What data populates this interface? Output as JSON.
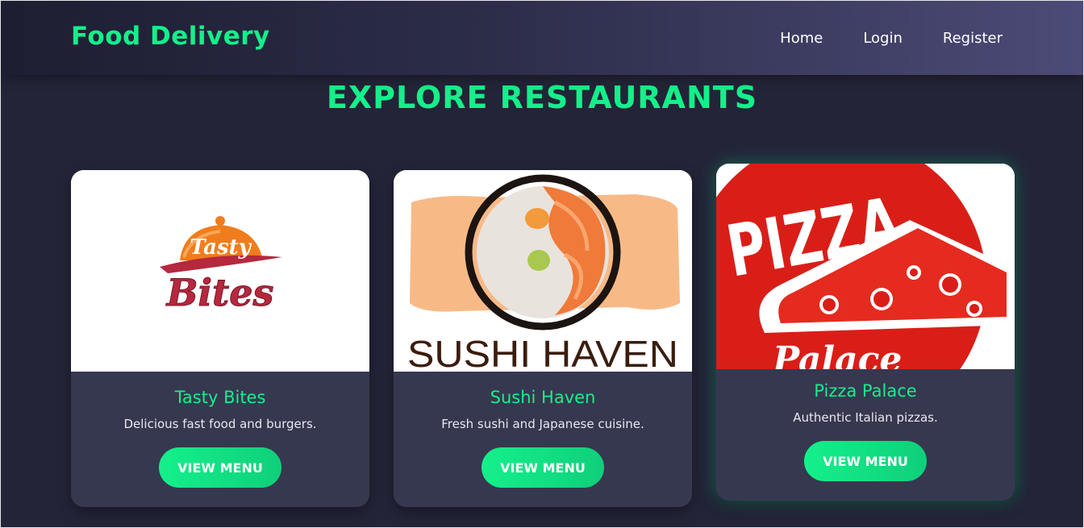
{
  "navbar": {
    "brand": "Food Delivery",
    "links": [
      "Home",
      "Login",
      "Register"
    ]
  },
  "main": {
    "title": "EXPLORE RESTAURANTS"
  },
  "restaurants": [
    {
      "name": "Tasty Bites",
      "description": "Delicious fast food and burgers.",
      "button": "VIEW MENU",
      "logo_text": [
        "Tasty",
        "Bites"
      ]
    },
    {
      "name": "Sushi Haven",
      "description": "Fresh sushi and Japanese cuisine.",
      "button": "VIEW MENU",
      "logo_text": [
        "SUSHI HAVEN"
      ]
    },
    {
      "name": "Pizza Palace",
      "description": "Authentic Italian pizzas.",
      "button": "VIEW MENU",
      "logo_text": [
        "PIZZA",
        "Palace"
      ]
    }
  ],
  "colors": {
    "accent": "#14f08a",
    "background": "#232438",
    "card": "#363850",
    "navbar_start": "#1d1e31",
    "navbar_end": "#4b4b77"
  }
}
